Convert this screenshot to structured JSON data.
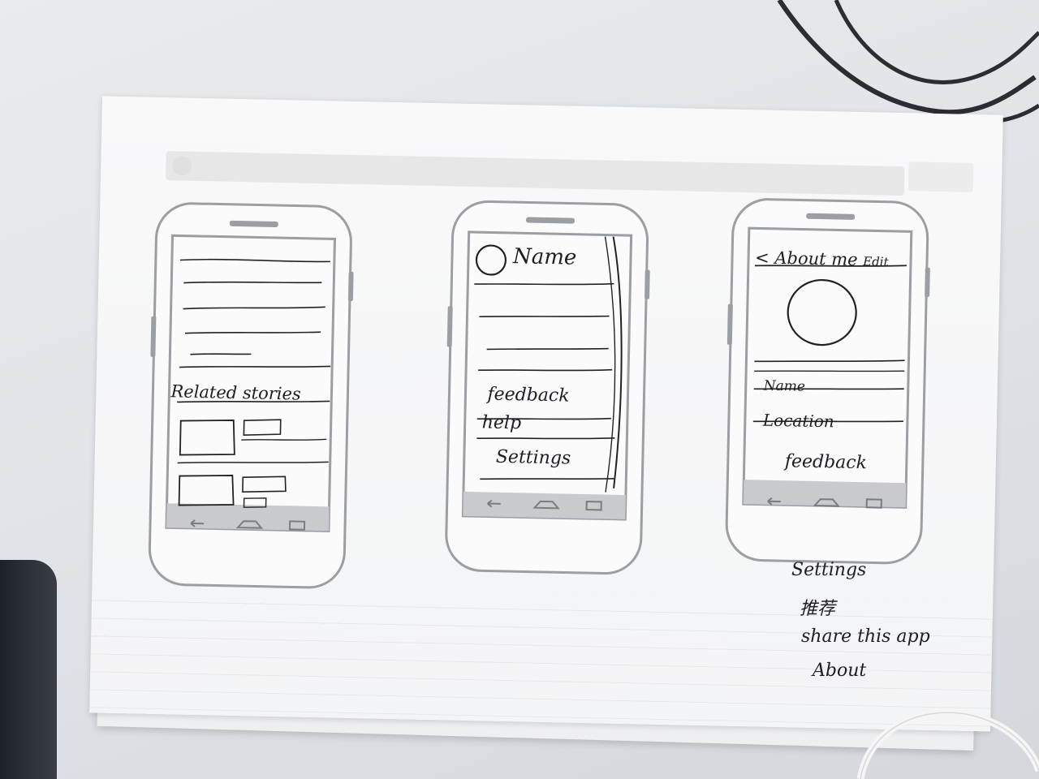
{
  "screen1": {
    "section_label": "Related stories"
  },
  "screen2": {
    "profile_name": "Name",
    "menu_items": [
      "feedback",
      "help",
      "Settings"
    ]
  },
  "screen3": {
    "back_arrow": "<",
    "title": "About me",
    "edit": "Edit",
    "fields": [
      "Name",
      "Location"
    ],
    "feedback": "feedback"
  },
  "annotations": {
    "lines": [
      "Settings",
      "推荐",
      "share this app",
      "About"
    ]
  },
  "icons": {
    "nav_back": "back-arrow-icon",
    "nav_home": "home-icon",
    "nav_recents": "recents-icon"
  }
}
